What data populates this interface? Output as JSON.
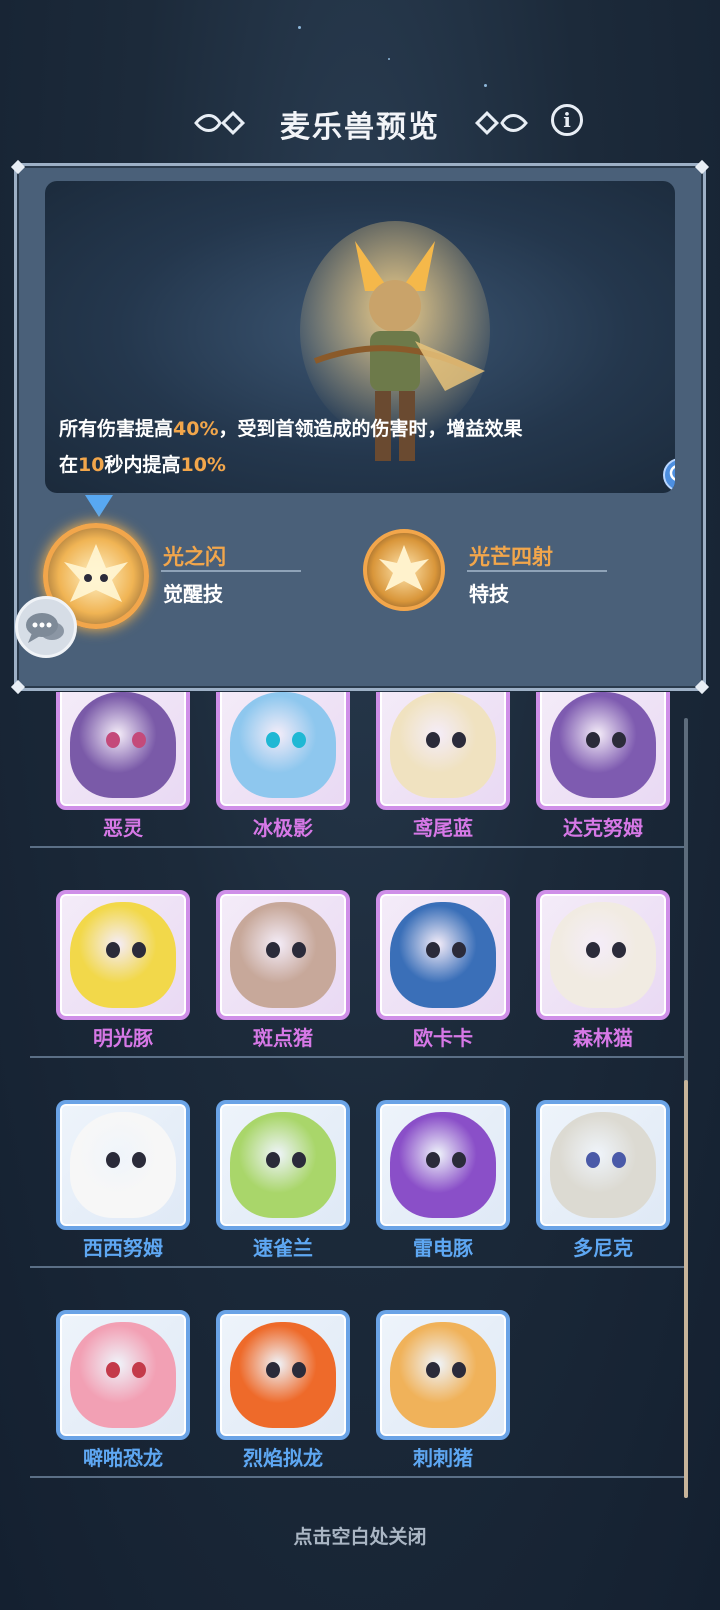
{
  "header": {
    "title": "麦乐兽预览",
    "info_label": "i"
  },
  "skill_panel": {
    "description": {
      "line1": [
        "所有伤害提高",
        "40%",
        "，受到首领造成的伤害时，增益效果"
      ],
      "line2": [
        "在",
        "10",
        "秒内提高",
        "10%"
      ]
    },
    "skills": [
      {
        "name": "光之闪",
        "type": "觉醒技",
        "selected": true
      },
      {
        "name": "光芒四射",
        "type": "特技",
        "selected": false
      }
    ]
  },
  "monsters": [
    {
      "name": "恶灵",
      "rarity": "purple",
      "color": "#7a5aa8",
      "eye": "#c44a7a"
    },
    {
      "name": "冰极影",
      "rarity": "purple",
      "color": "#8ec7ee",
      "eye": "#1fb8d4"
    },
    {
      "name": "鸢尾蓝",
      "rarity": "purple",
      "color": "#f0e2c0",
      "eye": "#2b2b3a"
    },
    {
      "name": "达克努姆",
      "rarity": "purple",
      "color": "#7e5bb0",
      "eye": "#2b2b3a"
    },
    {
      "name": "明光豚",
      "rarity": "purple",
      "color": "#f2d84a",
      "eye": "#2b2b3a"
    },
    {
      "name": "斑点猪",
      "rarity": "purple",
      "color": "#c7a89a",
      "eye": "#2b2b3a"
    },
    {
      "name": "欧卡卡",
      "rarity": "purple",
      "color": "#3a6fb8",
      "eye": "#2b2b3a"
    },
    {
      "name": "森林猫",
      "rarity": "purple",
      "color": "#f1ebe2",
      "eye": "#2b2b3a"
    },
    {
      "name": "西西努姆",
      "rarity": "blue",
      "color": "#f7f7f7",
      "eye": "#2b2b3a"
    },
    {
      "name": "速雀兰",
      "rarity": "blue",
      "color": "#a9d66a",
      "eye": "#2b2b3a"
    },
    {
      "name": "雷电豚",
      "rarity": "blue",
      "color": "#8a4fc8",
      "eye": "#2b2b3a"
    },
    {
      "name": "多尼克",
      "rarity": "blue",
      "color": "#dcdad2",
      "eye": "#4a5aa8"
    },
    {
      "name": "噼啪恐龙",
      "rarity": "blue",
      "color": "#f2a0b4",
      "eye": "#c43a4a"
    },
    {
      "name": "烈焰拟龙",
      "rarity": "blue",
      "color": "#ee6a2a",
      "eye": "#2b2b3a"
    },
    {
      "name": "刺刺猪",
      "rarity": "blue",
      "color": "#f0b25a",
      "eye": "#2b2b3a"
    }
  ],
  "footer": {
    "close_hint": "点击空白处关闭"
  },
  "colors": {
    "accent_orange": "#f2a64b",
    "purple_rarity": "#cf8fe8",
    "blue_rarity": "#6aa3e6"
  }
}
